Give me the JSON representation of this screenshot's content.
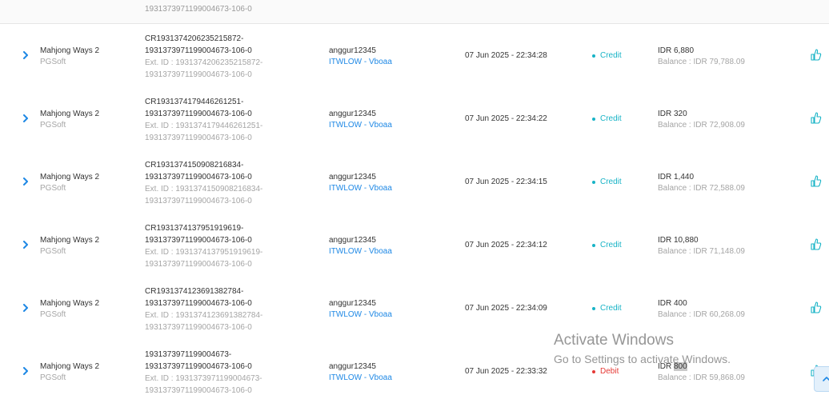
{
  "top_remnant": {
    "ext_line": "1931373971199004673-106-0"
  },
  "rows": [
    {
      "game": "Mahjong Ways 2",
      "provider": "PGSoft",
      "txn_line1": "CR1931374206235215872-",
      "txn_line2": "1931373971199004673-106-0",
      "ext_line1": "Ext. ID : 1931374206235215872-",
      "ext_line2": "1931373971199004673-106-0",
      "username": "anggur12345",
      "agent": "ITWLOW - Vboaa",
      "date": "07 Jun 2025 - 22:34:28",
      "type": "Credit",
      "type_color": "#17b3c6",
      "amount": "IDR 6,880",
      "balance": "Balance : IDR 79,788.09"
    },
    {
      "game": "Mahjong Ways 2",
      "provider": "PGSoft",
      "txn_line1": "CR1931374179446261251-",
      "txn_line2": "1931373971199004673-106-0",
      "ext_line1": "Ext. ID : 1931374179446261251-",
      "ext_line2": "1931373971199004673-106-0",
      "username": "anggur12345",
      "agent": "ITWLOW - Vboaa",
      "date": "07 Jun 2025 - 22:34:22",
      "type": "Credit",
      "type_color": "#17b3c6",
      "amount": "IDR 320",
      "balance": "Balance : IDR 72,908.09"
    },
    {
      "game": "Mahjong Ways 2",
      "provider": "PGSoft",
      "txn_line1": "CR1931374150908216834-",
      "txn_line2": "1931373971199004673-106-0",
      "ext_line1": "Ext. ID : 1931374150908216834-",
      "ext_line2": "1931373971199004673-106-0",
      "username": "anggur12345",
      "agent": "ITWLOW - Vboaa",
      "date": "07 Jun 2025 - 22:34:15",
      "type": "Credit",
      "type_color": "#17b3c6",
      "amount": "IDR 1,440",
      "balance": "Balance : IDR 72,588.09"
    },
    {
      "game": "Mahjong Ways 2",
      "provider": "PGSoft",
      "txn_line1": "CR1931374137951919619-",
      "txn_line2": "1931373971199004673-106-0",
      "ext_line1": "Ext. ID : 1931374137951919619-",
      "ext_line2": "1931373971199004673-106-0",
      "username": "anggur12345",
      "agent": "ITWLOW - Vboaa",
      "date": "07 Jun 2025 - 22:34:12",
      "type": "Credit",
      "type_color": "#17b3c6",
      "amount": "IDR 10,880",
      "balance": "Balance : IDR 71,148.09"
    },
    {
      "game": "Mahjong Ways 2",
      "provider": "PGSoft",
      "txn_line1": "CR1931374123691382784-",
      "txn_line2": "1931373971199004673-106-0",
      "ext_line1": "Ext. ID : 1931374123691382784-",
      "ext_line2": "1931373971199004673-106-0",
      "username": "anggur12345",
      "agent": "ITWLOW - Vboaa",
      "date": "07 Jun 2025 - 22:34:09",
      "type": "Credit",
      "type_color": "#17b3c6",
      "amount": "IDR 400",
      "balance": "Balance : IDR 60,268.09"
    },
    {
      "game": "Mahjong Ways 2",
      "provider": "PGSoft",
      "txn_line1": "1931373971199004673-",
      "txn_line2": "1931373971199004673-106-0",
      "ext_line1": "Ext. ID : 1931373971199004673-",
      "ext_line2": "1931373971199004673-106-0",
      "username": "anggur12345",
      "agent": "ITWLOW - Vboaa",
      "date": "07 Jun 2025 - 22:33:32",
      "type": "Debit",
      "type_color": "#e53935",
      "amount_prefix": "IDR ",
      "amount_highlight": "800",
      "balance": "Balance : IDR 59,868.09"
    }
  ],
  "icons": {
    "expand": "chevron-right-icon",
    "action": "thumbs-up-icon",
    "scroll": "chevron-up-icon"
  },
  "watermark": {
    "title": "Activate Windows",
    "subtitle": "Go to Settings to activate Windows."
  }
}
